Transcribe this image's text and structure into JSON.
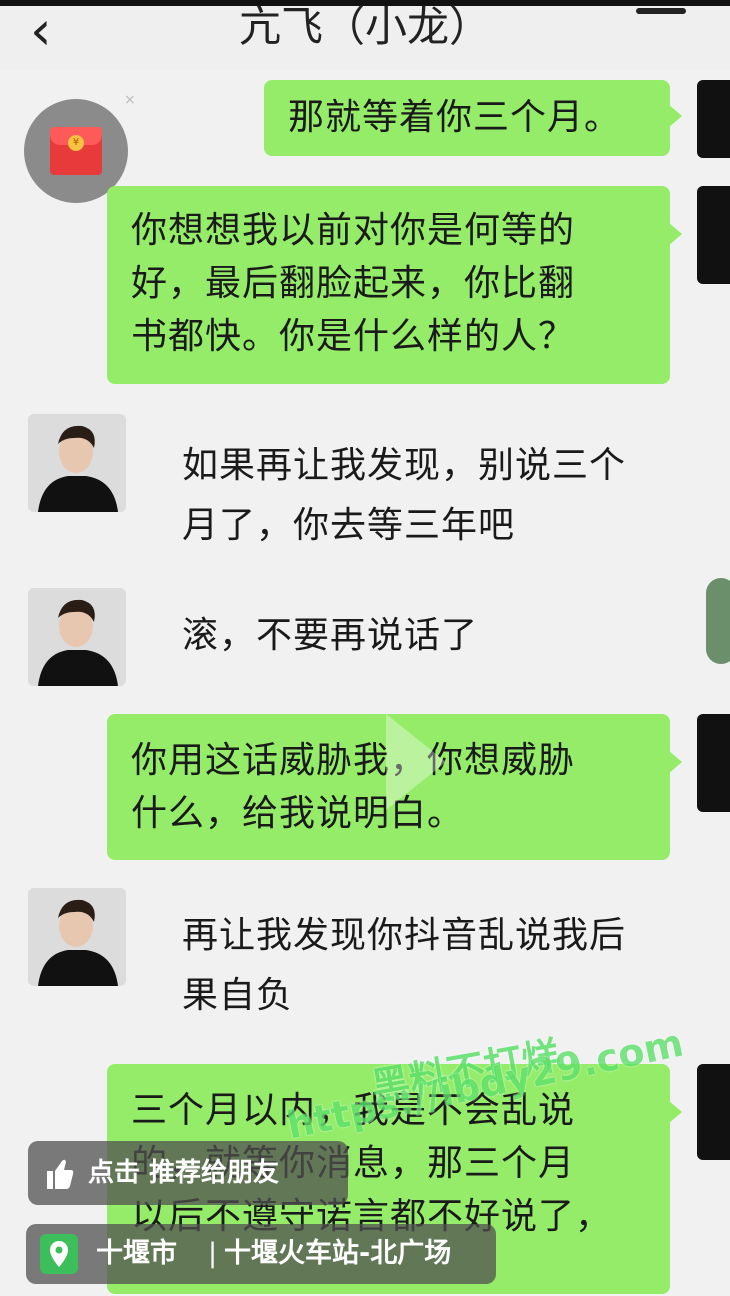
{
  "header": {
    "back_icon": "chevron-left-icon",
    "title": "亢飞（小龙）",
    "menu_icon": "more-menu-icon"
  },
  "messages": [
    {
      "side": "right",
      "text": "那就等着你三个月。"
    },
    {
      "side": "right",
      "text": "你想想我以前对你是何等的\n好，最后翻脸起来，你比翻\n书都快。你是什么样的人？"
    },
    {
      "side": "left",
      "text": "如果再让我发现，别说三个\n月了，你去等三年吧"
    },
    {
      "side": "left",
      "text": "滚，不要再说话了"
    },
    {
      "side": "right",
      "text": "你用这话威胁我，你想威胁\n什么，给我说明白。"
    },
    {
      "side": "left",
      "text": "再让我发现你抖音乱说我后\n果自负"
    },
    {
      "side": "right",
      "text": "三个月以内，我是不会乱说\n的，就等你消息，那三个月\n以后不遵守诺言都不好说了，"
    }
  ],
  "red_packet": {
    "icon": "red-envelope-icon",
    "coin": "¥"
  },
  "video_overlay": {
    "recommend_label": "点击 推荐给朋友",
    "recommend_icon": "thumbs-up-icon",
    "location_city": "十堰市",
    "location_place": "十堰火车站-北广场",
    "location_icon": "location-pin-icon"
  },
  "watermark": {
    "line1": "黑料不打烊",
    "line2": "https://ibdy29.com"
  },
  "colors": {
    "bubble_green": "#95ec69",
    "background": "#f1f1f1"
  }
}
